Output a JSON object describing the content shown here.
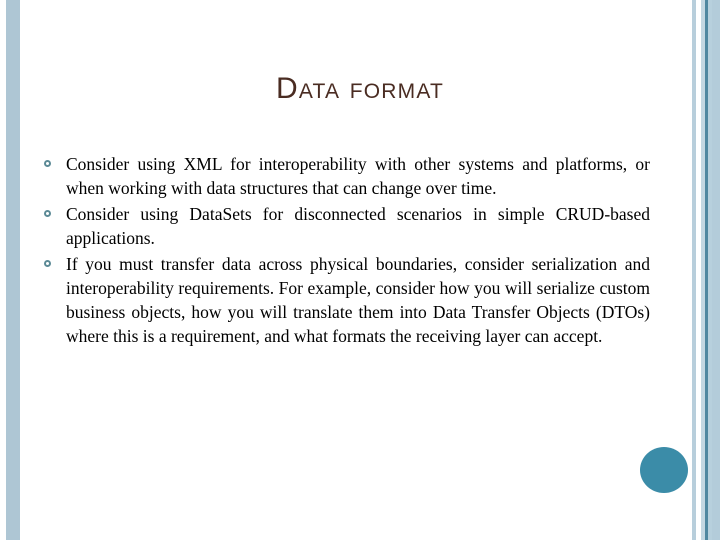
{
  "slide": {
    "title": "Data format",
    "title_color": "#4a2c22",
    "background_color": "#ffffff",
    "bullets": [
      {
        "marker": "hollow-circle",
        "text": "Consider using XML for interoperability with other systems and platforms, or when working with data structures that can change over time."
      },
      {
        "marker": "hollow-circle",
        "text": "Consider using DataSets for disconnected scenarios in simple CRUD-based applications."
      },
      {
        "marker": "hollow-circle",
        "text": "If you must transfer data across physical boundaries, consider serialization and interoperability requirements. For example, consider how you will serialize custom business objects, how you will translate them into Data Transfer Objects (DTOs) where this is a requirement, and what formats the receiving layer can accept."
      }
    ]
  },
  "decoration": {
    "left_bar_color": "#aec6d4",
    "bullet_marker_color": "#5c8a96",
    "accent_circle_color": "#3b8ca8",
    "right_stripe_colors": [
      "#ffffff",
      "#b8cedb",
      "#ffffff",
      "#c3d7e2",
      "#4f87a0",
      "#b7d0dd",
      "#b3ccda"
    ]
  }
}
